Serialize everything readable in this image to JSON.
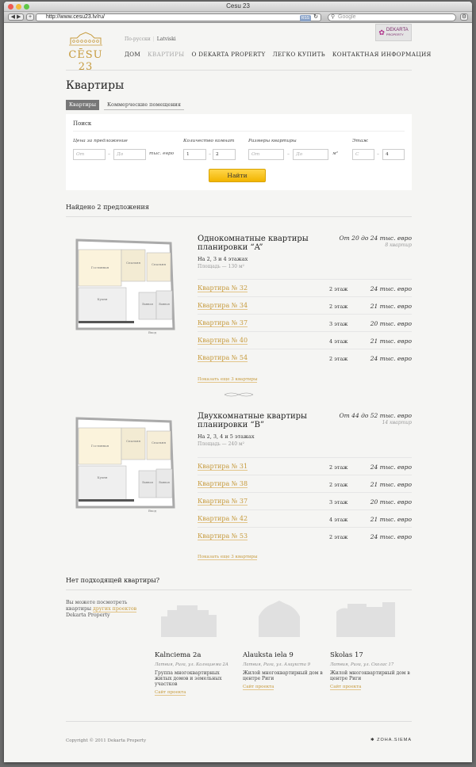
{
  "window": {
    "title": "Cesu 23"
  },
  "browser": {
    "url": "http://www.cesu23.lv/ru/",
    "search_placeholder": "Google",
    "rss": "RSS"
  },
  "brand": {
    "logo_text": "CĒSU 23",
    "partner": "DEKARTA",
    "partner_sub": "PROPERTY"
  },
  "lang": {
    "ru": "По-русски",
    "lv": "Latviski"
  },
  "nav": [
    "ДОМ",
    "КВАРТИРЫ",
    "О DEKARTA PROPERTY",
    "ЛЕГКО КУПИТЬ",
    "КОНТАКТНАЯ ИНФОРМАЦИЯ"
  ],
  "heading": "Квартиры",
  "tabs": {
    "apartments": "Квартиры",
    "commercial": "Коммерческие помещения"
  },
  "search": {
    "title": "Поиск",
    "price_label": "Цена за предложение",
    "price_from": "От",
    "price_to": "До",
    "price_unit": "тыс. евро",
    "rooms_label": "Количество комнат",
    "rooms_from": "1",
    "rooms_to": "2",
    "size_label": "Размеры квартиры",
    "size_from": "От",
    "size_to": "До",
    "size_unit": "м²",
    "floor_label": "Этаж",
    "floor_from": "С",
    "floor_to": "4",
    "button": "Найти"
  },
  "found": "Найдено 2 предложения",
  "offers": [
    {
      "title": "Однокомнатные квартиры планировки “A”",
      "price": "От 20 до 24 тыс. евро",
      "count": "8 квартир",
      "floors": "На 2, 3 и 4 этажах",
      "area": "Площадь — 130 м²",
      "rows": [
        {
          "apt": "Квартира № 32",
          "floor": "2 этаж",
          "price": "24 тыс. евро"
        },
        {
          "apt": "Квартира № 34",
          "floor": "2 этаж",
          "price": "21 тыс. евро"
        },
        {
          "apt": "Квартира № 37",
          "floor": "3 этаж",
          "price": "20 тыс. евро"
        },
        {
          "apt": "Квартира № 40",
          "floor": "4 этаж",
          "price": "21 тыс. евро"
        },
        {
          "apt": "Квартира № 54",
          "floor": "2 этаж",
          "price": "24 тыс. евро"
        }
      ],
      "more": "Показать еще 3 квартиры"
    },
    {
      "title": "Двухкомнатные квартиры планировки “B”",
      "price": "От 44 до 52 тыс. евро",
      "count": "14 квартир",
      "floors": "На 2, 3, 4 и 5 этажах",
      "area": "Площадь — 240 м²",
      "rows": [
        {
          "apt": "Квартира № 31",
          "floor": "2 этаж",
          "price": "24 тыс. евро"
        },
        {
          "apt": "Квартира № 38",
          "floor": "2 этаж",
          "price": "21 тыс. евро"
        },
        {
          "apt": "Квартира № 37",
          "floor": "3 этаж",
          "price": "20 тыс. евро"
        },
        {
          "apt": "Квартира № 42",
          "floor": "4 этаж",
          "price": "21 тыс. евро"
        },
        {
          "apt": "Квартира № 53",
          "floor": "2 этаж",
          "price": "24 тыс. евро"
        }
      ],
      "more": "Показать еще 3 квартиры"
    }
  ],
  "plan_labels": {
    "living": "Гостинная",
    "bedroom": "Спальня",
    "kitchen": "Кухня",
    "bath": "Ванная",
    "entrance": "Вход"
  },
  "no_match": {
    "title": "Нет подходящей квартиры?",
    "note_before": "Вы можете посмотреть квартиры",
    "note_link": "других проектов",
    "note_after": "Dekarta Property"
  },
  "projects": [
    {
      "name": "Kalnciema 2a",
      "addr": "Латвия, Рига, ул. Калнциема 2А",
      "desc": "Группа многоквартирных жилых домов и земельных участков",
      "link": "Сайт проекта"
    },
    {
      "name": "Alauksta iela 9",
      "addr": "Латвия, Рига, ул. Алаукста 9",
      "desc": "Жилой многоквартирный дом в центре Риги",
      "link": "Сайт проекта"
    },
    {
      "name": "Skolas 17",
      "addr": "Латвия, Рига, ул. Сколас 17",
      "desc": "Жилой многоквартирный дом в центре Риги",
      "link": "Сайт проекта"
    }
  ],
  "footer": {
    "copyright": "Copyright © 2011 Dekarta Property",
    "brand": "ZOHA.SIEMA"
  },
  "colors": {
    "accent": "#c69a3c",
    "button": "#f7c51e",
    "tab_active": "#777777"
  }
}
